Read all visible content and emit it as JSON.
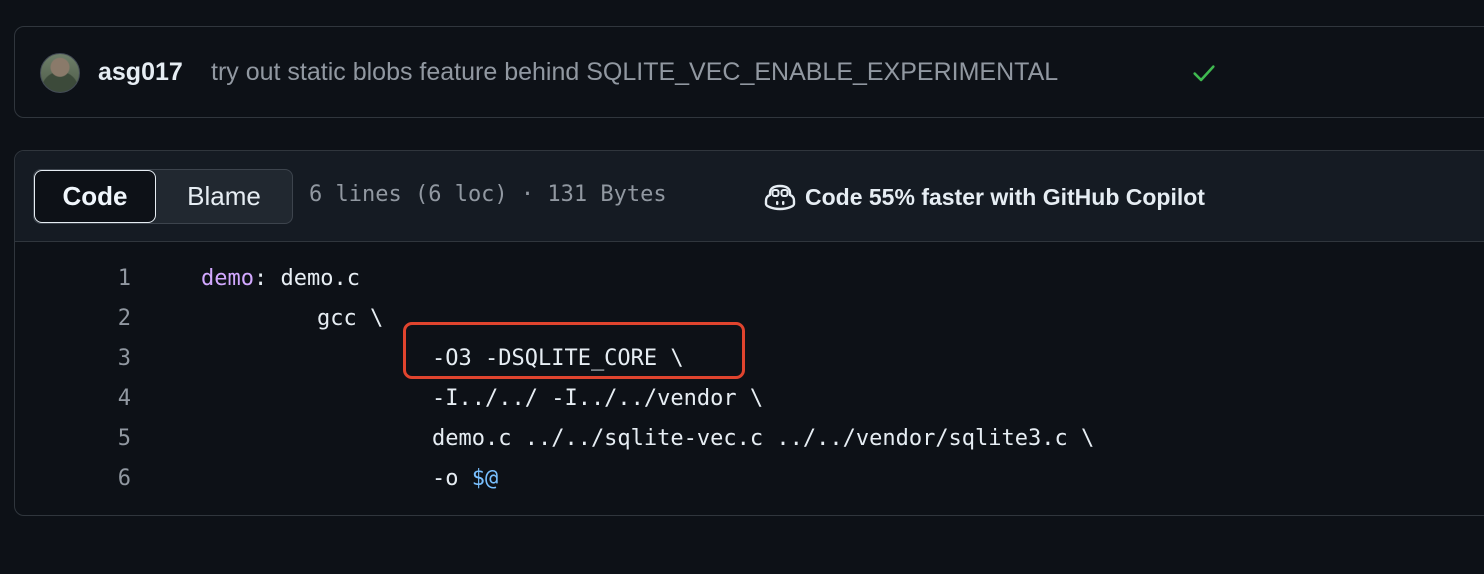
{
  "commit": {
    "author": "asg017",
    "message": "try out static blobs feature behind SQLITE_VEC_ENABLE_EXPERIMENTAL",
    "status_icon": "check-icon",
    "status_color": "#3fb950"
  },
  "file": {
    "tabs": [
      {
        "label": "Code",
        "selected": true
      },
      {
        "label": "Blame",
        "selected": false
      }
    ],
    "meta": "6 lines (6 loc) · 131 Bytes",
    "copilot_label": "Code 55% faster with GitHub Copilot"
  },
  "code": {
    "lines": [
      {
        "num": "1",
        "target": "demo",
        "rest": ": demo.c"
      },
      {
        "num": "2",
        "text": "gcc \\"
      },
      {
        "num": "3",
        "text": "-O3 -DSQLITE_CORE \\"
      },
      {
        "num": "4",
        "text": "-I../../ -I../../vendor \\"
      },
      {
        "num": "5",
        "text": "demo.c ../../sqlite-vec.c ../../vendor/sqlite3.c \\"
      },
      {
        "num": "6",
        "text": "-o ",
        "var": "$@"
      }
    ]
  },
  "colors": {
    "highlight_border": "#e0442e",
    "target_color": "#d2a8ff",
    "variable_color": "#79c0ff"
  }
}
